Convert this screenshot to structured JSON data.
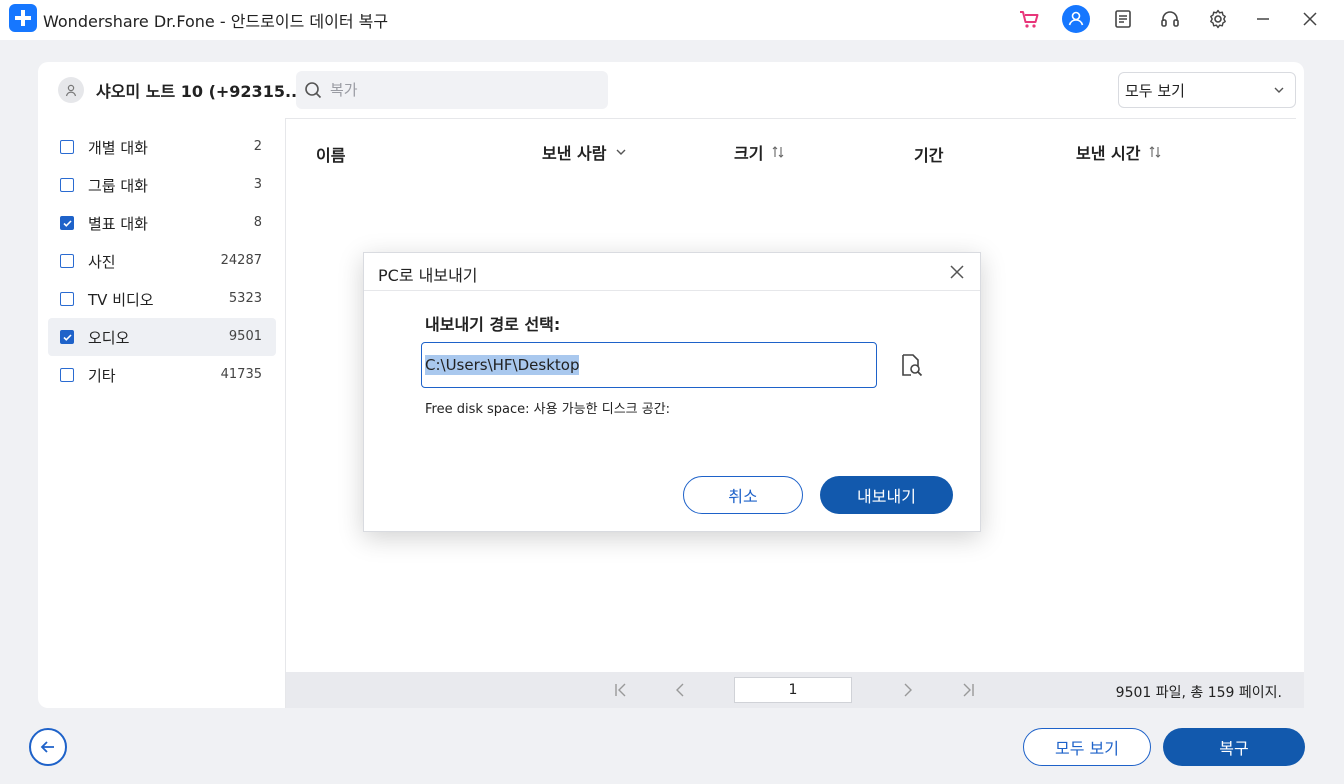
{
  "app": {
    "title": "Wondershare Dr.Fone - 안드로이드 데이터 복구"
  },
  "titlebar_icons": [
    "cart-icon",
    "user-icon",
    "feedback-icon",
    "support-icon",
    "gear-icon",
    "minimize-icon",
    "close-icon"
  ],
  "device": {
    "name": "샤오미 노트 10 (+92315..."
  },
  "search": {
    "placeholder": "복가"
  },
  "view_filter": {
    "selected": "모두 보기"
  },
  "categories": [
    {
      "label": "개별 대화",
      "count": "2",
      "checked": false
    },
    {
      "label": "그룹 대화",
      "count": "3",
      "checked": false
    },
    {
      "label": "별표 대화",
      "count": "8",
      "checked": true
    },
    {
      "label": "사진",
      "count": "24287",
      "checked": false
    },
    {
      "label": "TV 비디오",
      "count": "5323",
      "checked": false
    },
    {
      "label": "오디오",
      "count": "9501",
      "checked": true,
      "active": true
    },
    {
      "label": "기타",
      "count": "41735",
      "checked": false
    }
  ],
  "table": {
    "columns": [
      "이름",
      "보낸 사람",
      "크기",
      "기간",
      "보낸 시간"
    ]
  },
  "pager": {
    "page": "1",
    "info": "9501 파일, 총 159 페이지."
  },
  "bottom": {
    "view_all": "모두 보기",
    "recover": "복구"
  },
  "dialog": {
    "title": "PC로 내보내기",
    "label": "내보내기 경로 선택:",
    "path": "C:\\Users\\HF\\Desktop",
    "disk_space": "Free disk space: 사용 가능한 디스크 공간:",
    "cancel": "취소",
    "export": "내보내기"
  },
  "colors": {
    "accent": "#1e62c9",
    "primary_button": "#1259ad",
    "selection": "#a9c8ee",
    "cart": "#e8367a"
  }
}
